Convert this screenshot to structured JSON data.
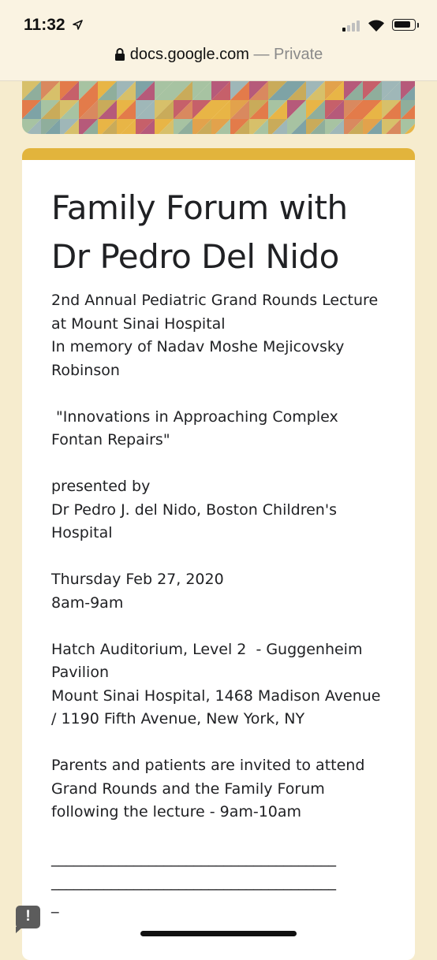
{
  "status_bar": {
    "time": "11:32",
    "icons": [
      "location-arrow-icon",
      "cellular-signal-icon",
      "wifi-icon",
      "battery-icon"
    ]
  },
  "url_bar": {
    "domain": "docs.google.com",
    "mode": " — Private",
    "icon": "lock-icon"
  },
  "form": {
    "accent_color": "#e2b43c",
    "title_line1": "Family Forum with",
    "title_line2": "Dr Pedro Del Nido",
    "description": [
      "2nd Annual Pediatric Grand Rounds Lecture",
      "at Mount Sinai Hospital",
      "In memory of Nadav Moshe Mejicovsky",
      "Robinson",
      "",
      " \"Innovations in Approaching Complex",
      "Fontan Repairs\"",
      "",
      "presented by",
      "Dr Pedro J. del Nido, Boston Children's",
      "Hospital",
      "",
      "Thursday Feb 27, 2020",
      "8am-9am",
      "",
      "Hatch Auditorium, Level 2  - Guggenheim",
      "Pavilion",
      "Mount Sinai Hospital, 1468 Madison Avenue",
      "/ 1190 Fifth Avenue, New York, NY",
      "",
      "Parents and patients are invited to attend",
      "Grand Rounds and the Family Forum",
      "following the lecture - 9am-10am",
      "",
      "______________________________________",
      "______________________________________",
      "_"
    ]
  },
  "feedback": {
    "icon": "report-feedback-icon",
    "mark": "!"
  }
}
